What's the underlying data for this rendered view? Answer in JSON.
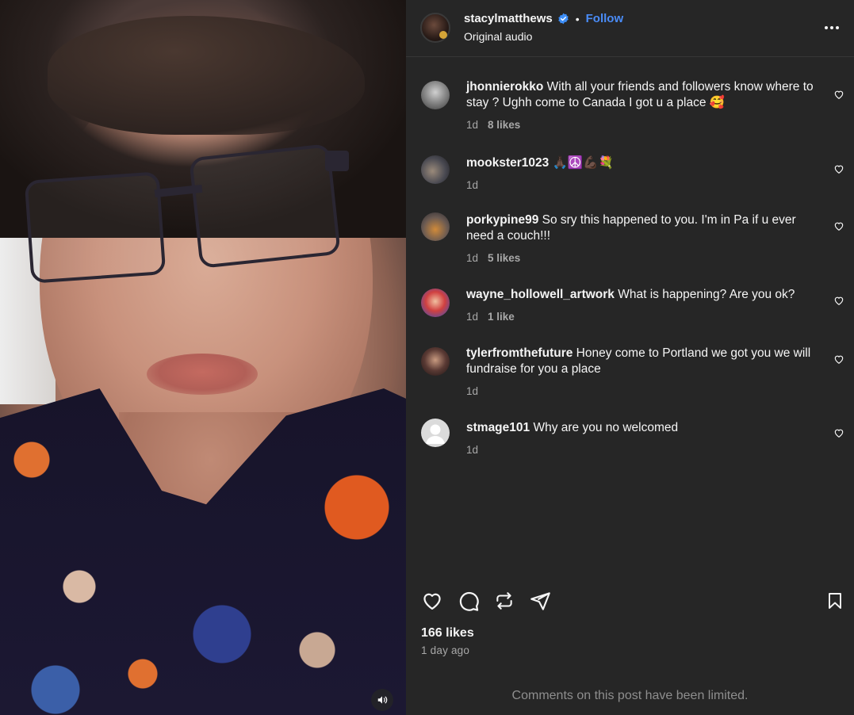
{
  "media": {
    "mute_icon": "speaker-icon"
  },
  "header": {
    "username": "stacylmatthews",
    "separator": "•",
    "follow_label": "Follow",
    "subtitle": "Original audio",
    "more_icon": "more-horizontal-icon"
  },
  "comments": [
    {
      "username": "jhonnierokko",
      "text": "With all your friends and followers know where to stay ? Ughh come to Canada I got u a place 🥰",
      "time": "1d",
      "likes": "8 likes"
    },
    {
      "username": "mookster1023",
      "text": "🙏🏿☮️💪🏿💐",
      "time": "1d",
      "likes": ""
    },
    {
      "username": "porkypine99",
      "text": "So sry this happened to you. I'm in Pa if u ever need a couch!!!",
      "time": "1d",
      "likes": "5 likes"
    },
    {
      "username": "wayne_hollowell_artwork",
      "text": "What is happening? Are you ok?",
      "time": "1d",
      "likes": "1 like"
    },
    {
      "username": "tylerfromthefuture",
      "text": "Honey come to Portland we got you we will fundraise for you a place",
      "time": "1d",
      "likes": ""
    },
    {
      "username": "stmage101",
      "text": "Why are you no welcomed",
      "time": "1d",
      "likes": ""
    }
  ],
  "actions": {
    "like_icon": "heart-icon",
    "comment_icon": "comment-icon",
    "repost_icon": "repost-icon",
    "share_icon": "send-icon",
    "save_icon": "bookmark-icon"
  },
  "post": {
    "likes": "166 likes",
    "date": "1 day ago",
    "limited_notice": "Comments on this post have been limited."
  },
  "colors": {
    "background": "#262626",
    "accent_link": "#4a8cf7",
    "verified": "#3d8ef7",
    "secondary_text": "#a8a8a8"
  }
}
